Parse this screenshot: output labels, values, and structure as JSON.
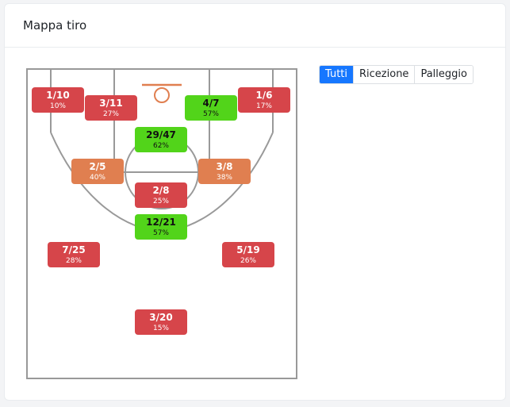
{
  "card": {
    "title": "Mappa tiro"
  },
  "filters": [
    {
      "label": "Tutti",
      "active": true
    },
    {
      "label": "Ricezione",
      "active": false
    },
    {
      "label": "Palleggio",
      "active": false
    }
  ],
  "colors": {
    "red": "#d6454a",
    "orange": "#e07f50",
    "green": "#52d41a",
    "court_line": "#999999",
    "rim": "#e07f50",
    "active_button": "#1677ff"
  },
  "zones": [
    {
      "id": "left-corner",
      "made": "1/10",
      "pct": "10%",
      "color": "red"
    },
    {
      "id": "left-baseline",
      "made": "3/11",
      "pct": "27%",
      "color": "red"
    },
    {
      "id": "right-baseline",
      "made": "4/7",
      "pct": "57%",
      "color": "green"
    },
    {
      "id": "right-corner",
      "made": "1/6",
      "pct": "17%",
      "color": "red"
    },
    {
      "id": "paint",
      "made": "29/47",
      "pct": "62%",
      "color": "green"
    },
    {
      "id": "left-wing-mid",
      "made": "2/5",
      "pct": "40%",
      "color": "orange"
    },
    {
      "id": "right-wing-mid",
      "made": "3/8",
      "pct": "38%",
      "color": "orange"
    },
    {
      "id": "free-throw",
      "made": "2/8",
      "pct": "25%",
      "color": "red"
    },
    {
      "id": "top-key",
      "made": "12/21",
      "pct": "57%",
      "color": "green"
    },
    {
      "id": "left-wing-three",
      "made": "7/25",
      "pct": "28%",
      "color": "red"
    },
    {
      "id": "right-wing-three",
      "made": "5/19",
      "pct": "26%",
      "color": "red"
    },
    {
      "id": "deep-three",
      "made": "3/20",
      "pct": "15%",
      "color": "red"
    }
  ]
}
